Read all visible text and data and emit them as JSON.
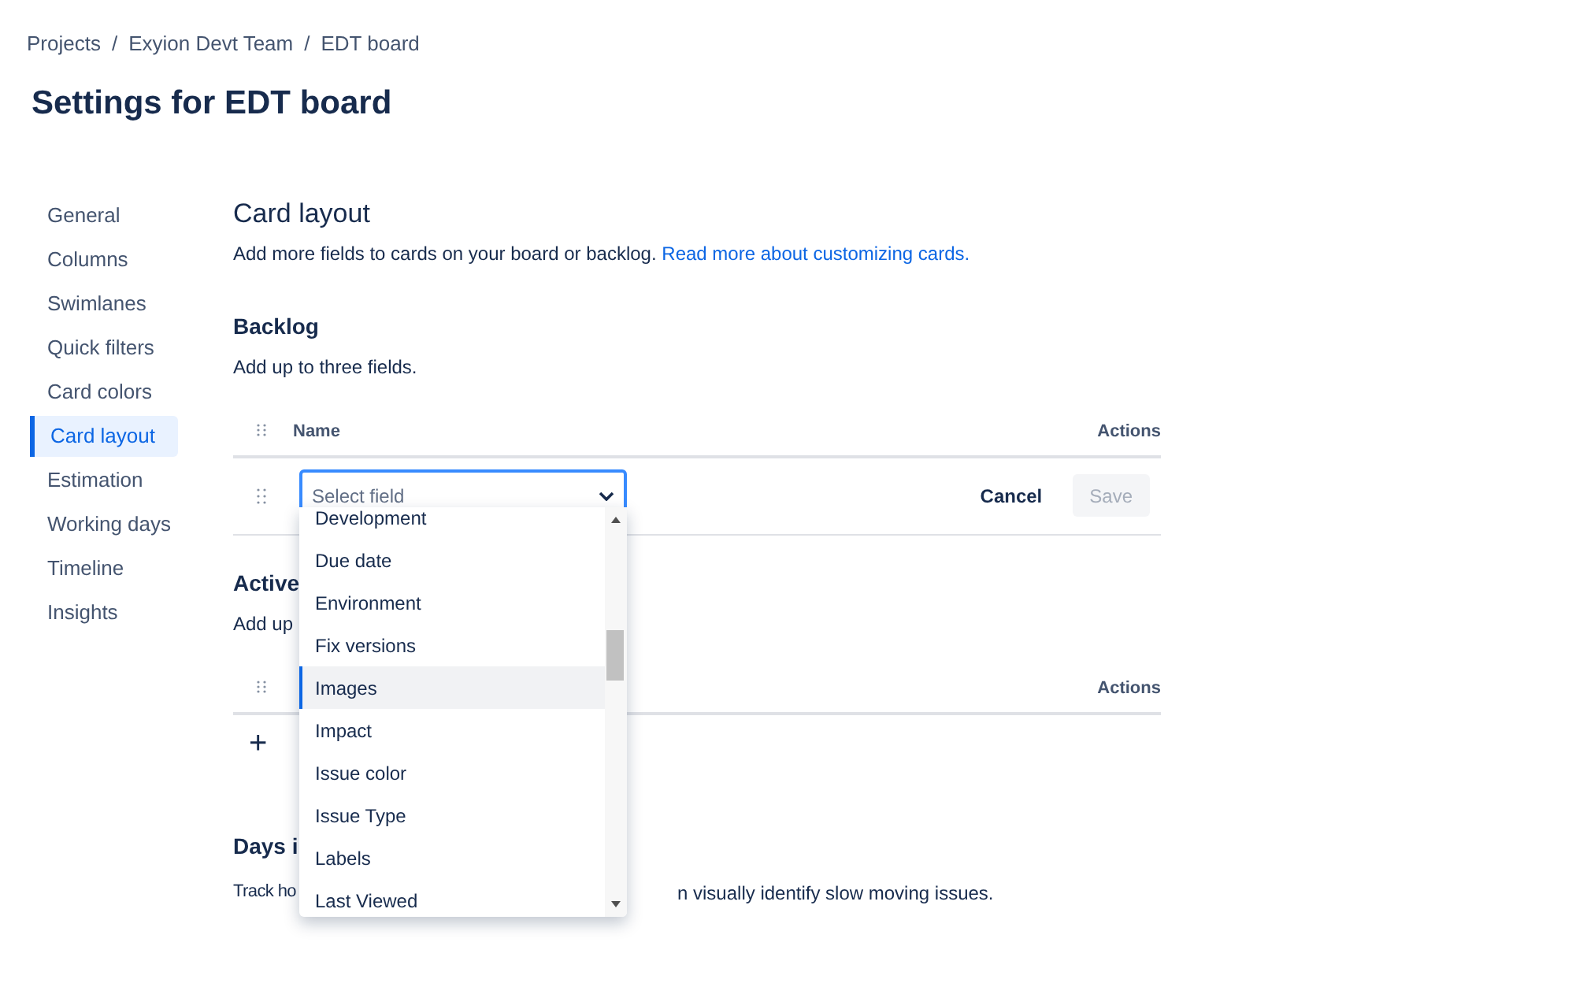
{
  "breadcrumbs": [
    {
      "label": "Projects",
      "separator": "/"
    },
    {
      "label": "Exyion Devt Team",
      "separator": "/"
    },
    {
      "label": "EDT board"
    }
  ],
  "title": "Settings for EDT board",
  "sidebar": {
    "items": [
      {
        "label": "General",
        "selected": false
      },
      {
        "label": "Columns",
        "selected": false
      },
      {
        "label": "Swimlanes",
        "selected": false
      },
      {
        "label": "Quick filters",
        "selected": false
      },
      {
        "label": "Card colors",
        "selected": false
      },
      {
        "label": "Card layout",
        "selected": true
      },
      {
        "label": "Estimation",
        "selected": false
      },
      {
        "label": "Working days",
        "selected": false
      },
      {
        "label": "Timeline",
        "selected": false
      },
      {
        "label": "Insights",
        "selected": false
      }
    ]
  },
  "content": {
    "heading": "Card layout",
    "description": "Add more fields to cards on your board or backlog.",
    "link": "Read more about customizing cards."
  },
  "backlog": {
    "heading": "Backlog",
    "description": "Add up to three fields.",
    "columns": {
      "name": "Name",
      "actions": "Actions"
    },
    "select": {
      "placeholder": "Select field"
    },
    "buttons": [
      {
        "label": "Cancel",
        "disabled": false
      },
      {
        "label": "Save",
        "disabled": true
      }
    ]
  },
  "active": {
    "heading": "Active",
    "description": "Add up",
    "columns": {
      "actions": "Actions"
    },
    "add_symbol": "+"
  },
  "days": {
    "heading": "Days i",
    "description_left": "Track ho",
    "description_right": "n visually identify slow moving issues."
  },
  "dropdown": {
    "options": [
      {
        "label": "Development",
        "selected": false
      },
      {
        "label": "Due date",
        "selected": false
      },
      {
        "label": "Environment",
        "selected": false
      },
      {
        "label": "Fix versions",
        "selected": false
      },
      {
        "label": "Images",
        "selected": true
      },
      {
        "label": "Impact",
        "selected": false
      },
      {
        "label": "Issue color",
        "selected": false
      },
      {
        "label": "Issue Type",
        "selected": false
      },
      {
        "label": "Labels",
        "selected": false
      },
      {
        "label": "Last Viewed",
        "selected": false
      }
    ]
  }
}
